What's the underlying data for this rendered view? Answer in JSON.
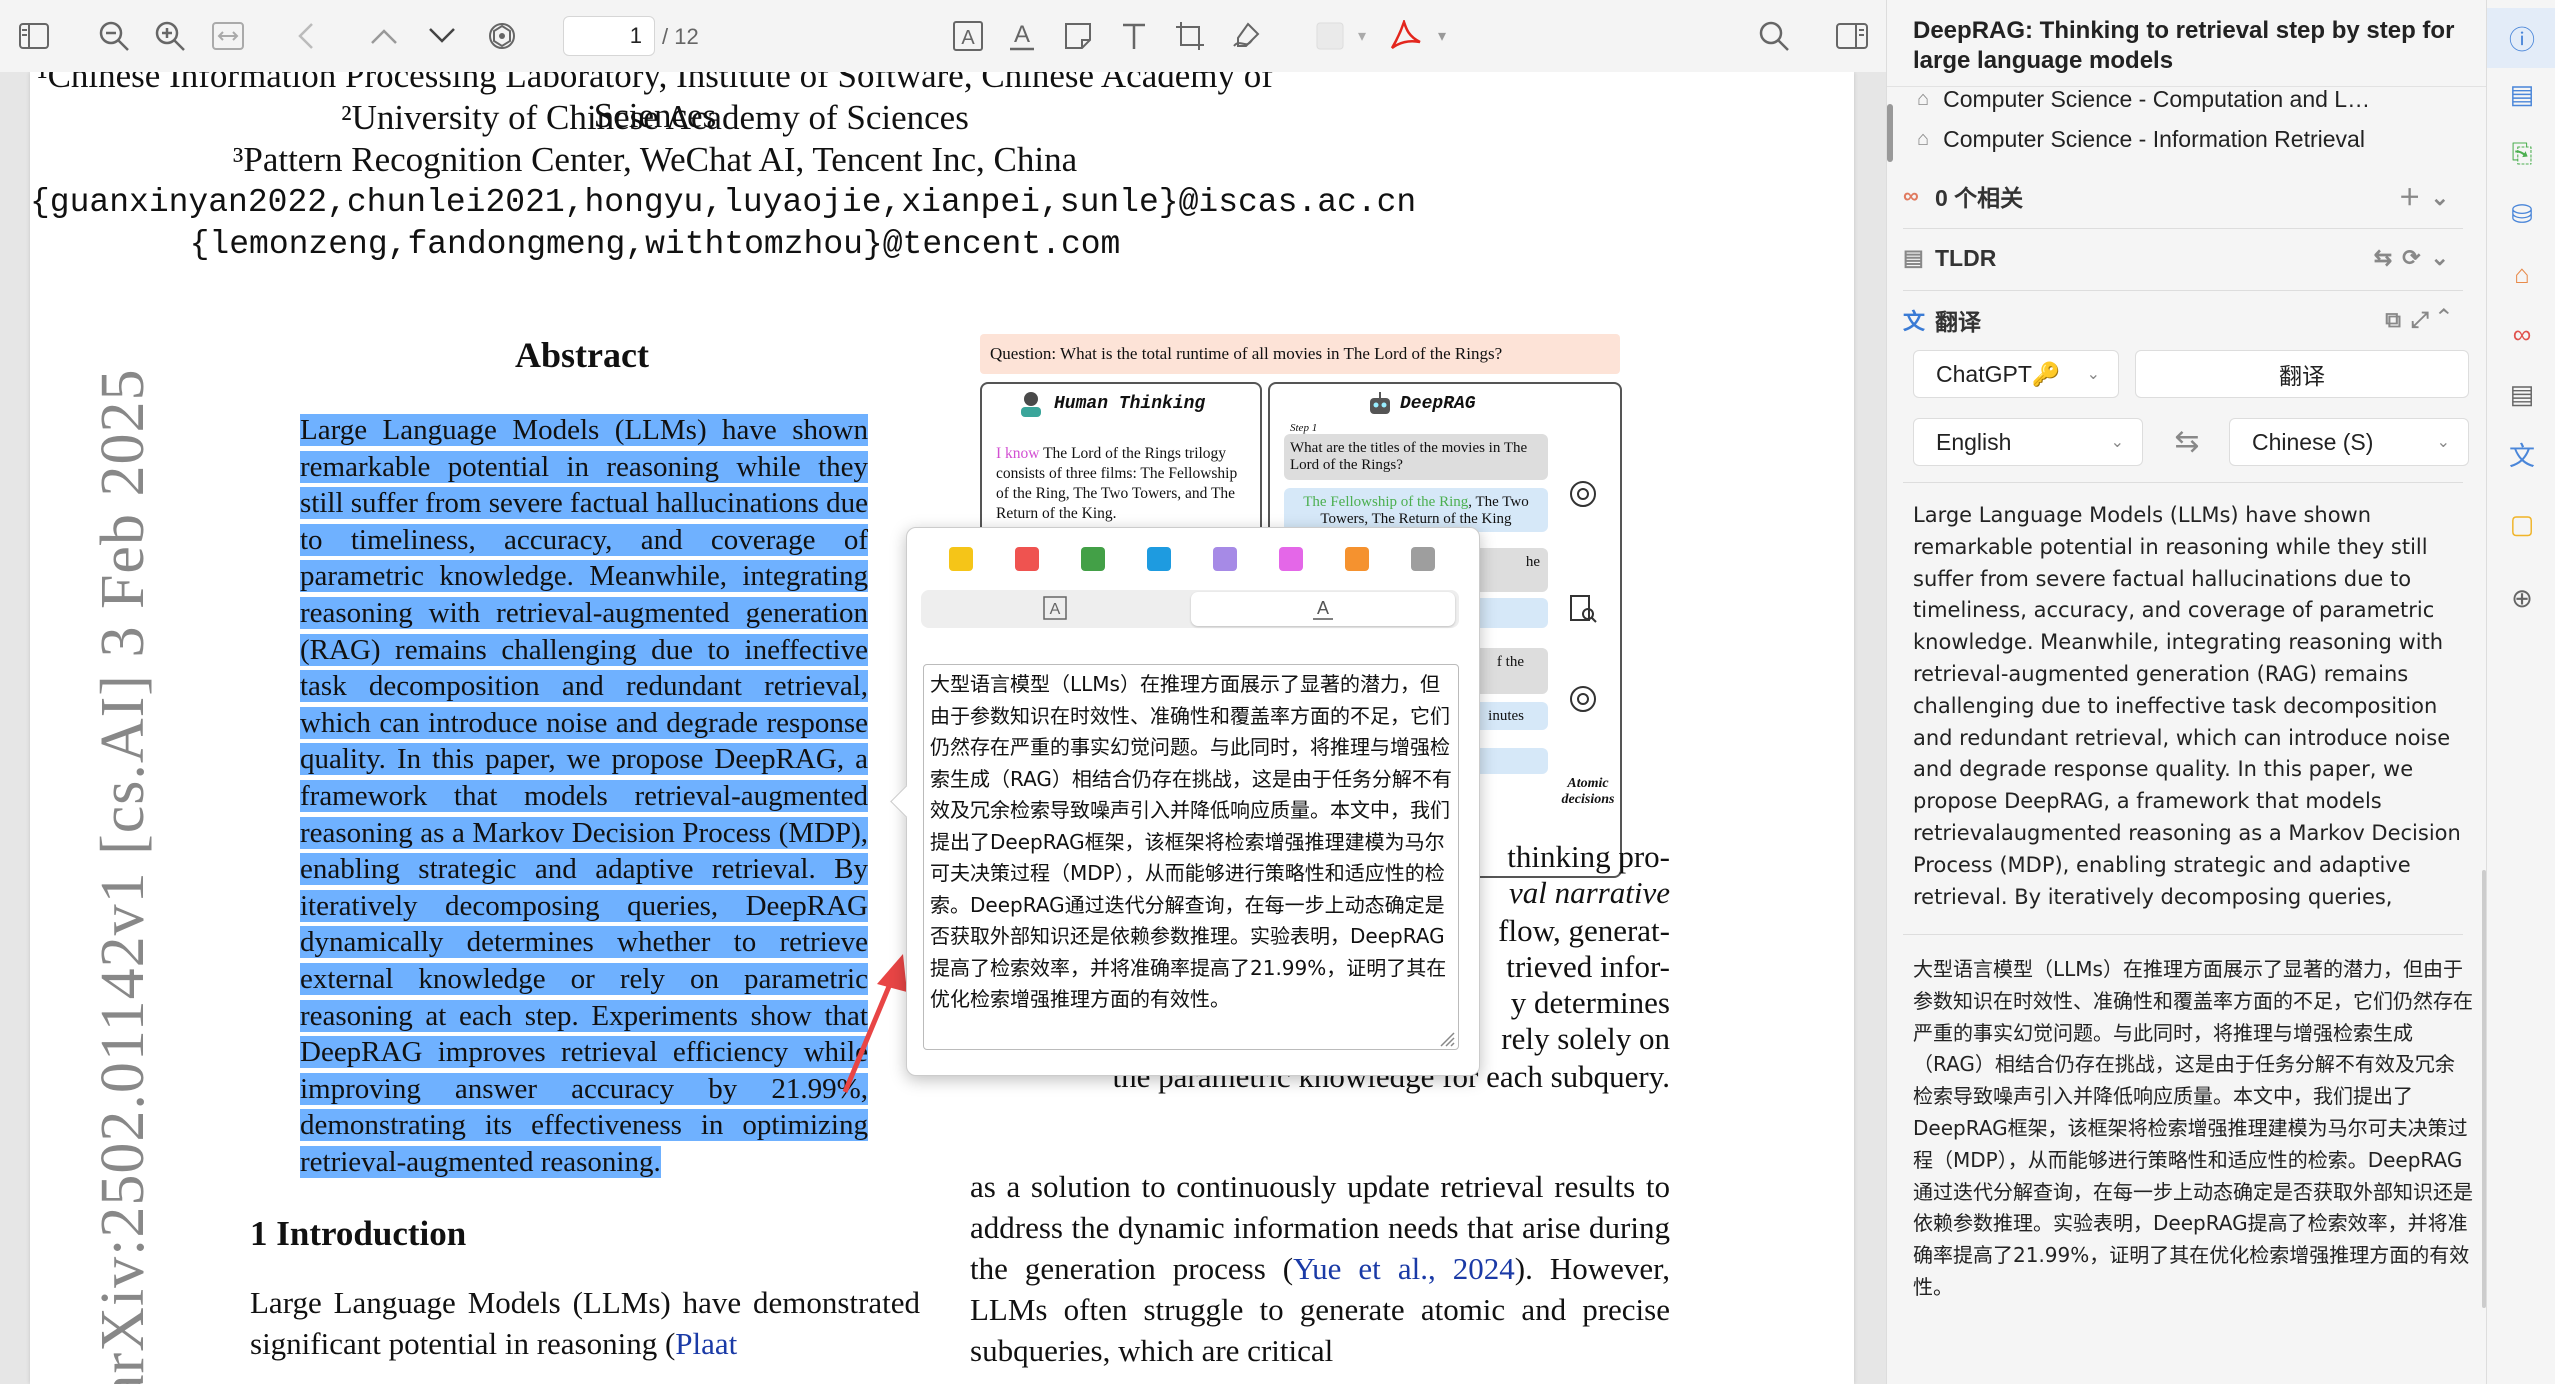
{
  "toolbar": {
    "page_current": "1",
    "page_total": "/ 12"
  },
  "document": {
    "affiliation_1": "¹Chinese Information Processing Laboratory, Institute of Software, Chinese Academy of Sciences",
    "affiliation_2": "²University of Chinese Academy of Sciences",
    "affiliation_3": "³Pattern Recognition Center, WeChat AI, Tencent Inc, China",
    "email_1": "{guanxinyan2022,chunlei2021,hongyu,luyaojie,xianpei,sunle}@iscas.ac.cn",
    "email_2": "{lemonzeng,fandongmeng,withtomzhou}@tencent.com",
    "arxiv_id": "arXiv:2502.01142v1  [cs.AI]  3 Feb 2025",
    "abstract_title": "Abstract",
    "abstract_text": "Large Language Models (LLMs) have shown remarkable potential in reasoning while they still suffer from severe factual hallucinations due to timeliness, accuracy, and coverage of parametric knowledge.  Meanwhile, integrating reasoning with retrieval-augmented generation (RAG) remains challenging due to ineffective task decomposition and redundant retrieval, which can introduce noise and degrade response quality.  In this paper, we propose DeepRAG, a framework that models retrieval-augmented reasoning as a Markov Decision Process (MDP), enabling strategic and adaptive retrieval. By iteratively decomposing queries, DeepRAG dynamically determines whether to retrieve external knowledge or rely on parametric reasoning at each step.  Experiments show that DeepRAG improves retrieval efficiency while improving answer accuracy by 21.99%, demonstrating its effectiveness in optimizing retrieval-augmented reasoning.",
    "intro_heading": "1   Introduction",
    "intro_text_1": "Large Language Models (LLMs) have demonstrated significant potential in reasoning (",
    "intro_link_1": "Plaat",
    "right_frag_1": "thinking pro-",
    "right_frag_2": "val narrative",
    "right_frag_3": "flow, generat-",
    "right_frag_4": "trieved infor-",
    "right_frag_5": "y determines",
    "right_frag_6": "rely solely on",
    "right_frag_7": "the parametric knowledge for each subquery.",
    "right_p2_a": "as a solution to continuously update retrieval results to address the dynamic information needs that arise during the generation process (",
    "right_p2_link": "Yue et al., 2024",
    "right_p2_b": "). However, LLMs often struggle to generate atomic and precise subqueries, which are critical"
  },
  "figure": {
    "question": "Question: What is the total runtime of all movies in The Lord of the Rings?",
    "human_title": "Human Thinking",
    "human_prefix": "I know",
    "human_text": "The Lord of the Rings trilogy consists of three films: The Fellowship of the Ring, The Two Towers, and The Return of the King.",
    "deeprag_title": "DeepRAG",
    "step_label": "Step 1",
    "step_q": "What are the titles of the movies in The Lord of the Rings?",
    "step_a_green": "The Fellowship of the Ring",
    "step_a_rest": ", The Two Towers, The Return of the King",
    "frag_1": "he",
    "frag_2": "f the",
    "frag_3": "inutes",
    "atomic_label": "Atomic decisions"
  },
  "popup": {
    "colors": [
      "#f5c518",
      "#ef5350",
      "#43a047",
      "#1e9be0",
      "#a68ae6",
      "#e467e8",
      "#f5922f",
      "#9e9e9e"
    ],
    "translation": "大型语言模型（LLMs）在推理方面展示了显著的潜力，但由于参数知识在时效性、准确性和覆盖率方面的不足，它们仍然存在严重的事实幻觉问题。与此同时，将推理与增强检索生成（RAG）相结合仍存在挑战，这是由于任务分解不有效及冗余检索导致噪声引入并降低响应质量。本文中，我们提出了DeepRAG框架，该框架将检索增强推理建模为马尔可夫决策过程（MDP），从而能够进行策略性和适应性的检索。DeepRAG通过迭代分解查询，在每一步上动态确定是否获取外部知识还是依赖参数推理。实验表明，DeepRAG提高了检索效率，并将准确率提高了21.99%，证明了其在优化检索增强推理方面的有效性。"
  },
  "sidebar": {
    "title": "DeepRAG: Thinking to retrieval step by step for large language models",
    "tag_1": "Computer Science - Computation and L…",
    "tag_2": "Computer Science - Information Retrieval",
    "related": "0 个相关",
    "tldr": "TLDR",
    "translate_section": "翻译",
    "engine": "ChatGPT🔑",
    "translate_button": "翻译",
    "source_lang": "English",
    "target_lang": "Chinese (S)",
    "source_text": "Large Language Models (LLMs) have shown remarkable potential in reasoning while they still suffer from severe factual hallucinations due to timeliness, accuracy, and coverage of parametric knowledge. Meanwhile, integrating reasoning with retrieval-augmented generation (RAG) remains challenging due to ineffective task decomposition and redundant retrieval, which can introduce noise and degrade response quality. In this paper, we propose DeepRAG, a framework that models retrievalaugmented reasoning as a Markov Decision Process (MDP), enabling strategic and adaptive retrieval. By iteratively decomposing queries, DeepRAG dynamically",
    "translated_text": "大型语言模型（LLMs）在推理方面展示了显著的潜力，但由于参数知识在时效性、准确性和覆盖率方面的不足，它们仍然存在严重的事实幻觉问题。与此同时，将推理与增强检索生成（RAG）相结合仍存在挑战，这是由于任务分解不有效及冗余检索导致噪声引入并降低响应质量。本文中，我们提出了DeepRAG框架，该框架将检索增强推理建模为马尔可夫决策过程（MDP），从而能够进行策略性和适应性的检索。DeepRAG通过迭代分解查询，在每一步上动态确定是否获取外部知识还是依赖参数推理。实验表明，DeepRAG提高了检索效率，并将准确率提高了21.99%，证明了其在优化检索增强推理方面的有效性。"
  }
}
